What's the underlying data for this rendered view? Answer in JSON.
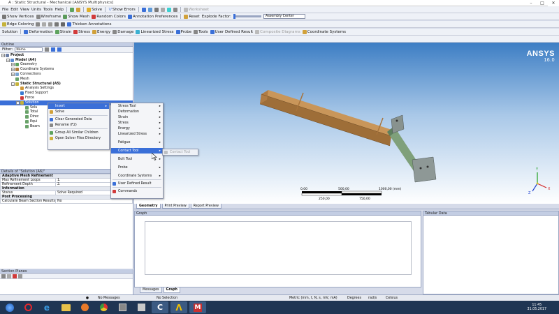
{
  "window": {
    "title": "A : Static Structural - Mechanical [ANSYS Multiphysics]",
    "buttons": [
      "–",
      "□",
      "✕"
    ]
  },
  "menubar": {
    "items": [
      "File",
      "Edit",
      "View",
      "Units",
      "Tools",
      "Help"
    ],
    "solve_label": "Solve",
    "show_errors_label": "Show Errors",
    "worksheet_label": "Worksheet"
  },
  "toolbar2": {
    "show_vertices": "Show Vertices",
    "wireframe": "Wireframe",
    "show_mesh": "Show Mesh",
    "random_colors": "Random Colors",
    "annotation_prefs": "Annotation Preferences",
    "reset": "Reset",
    "explode_label": "Explode Factor:",
    "assembly_center": "Assembly Center"
  },
  "toolbar3": {
    "edge_coloring": "Edge Coloring",
    "thicken_annotations": "Thicken Annotations"
  },
  "toolbar4": {
    "items": [
      "Solution",
      "Deformation",
      "Strain",
      "Stress",
      "Energy",
      "Damage",
      "Linearized Stress",
      "Probe",
      "Tools",
      "User Defined Result",
      "Coordinate Systems"
    ],
    "dimmed": "Composite Diagrams"
  },
  "outline": {
    "title": "Outline",
    "filter_label": "Filter:",
    "filter_value": "Name",
    "tree": [
      {
        "label": "Project",
        "indent": 0,
        "bold": true,
        "color": "#6b7ea6"
      },
      {
        "label": "Model (A4)",
        "indent": 1,
        "bold": true,
        "color": "#5b8bd1"
      },
      {
        "label": "Geometry",
        "indent": 2,
        "color": "#5ea35e"
      },
      {
        "label": "Coordinate Systems",
        "indent": 2,
        "color": "#b07a3a"
      },
      {
        "label": "Connections",
        "indent": 2,
        "color": "#7aa6d1"
      },
      {
        "label": "Mesh",
        "indent": 2,
        "color": "#6aa36a"
      },
      {
        "label": "Static Structural (A5)",
        "indent": 2,
        "bold": true,
        "color": "#c5b23a"
      },
      {
        "label": "Analysis Settings",
        "indent": 3,
        "color": "#d19a3a"
      },
      {
        "label": "Fixed Support",
        "indent": 3,
        "color": "#3a7ad1"
      },
      {
        "label": "Force",
        "indent": 3,
        "color": "#d13a3a"
      },
      {
        "label": "Solution",
        "indent": 3,
        "color": "#c5b23a",
        "selected": true
      },
      {
        "label": "Solu",
        "indent": 4,
        "color": "#6aa36a"
      },
      {
        "label": "Total",
        "indent": 4,
        "color": "#6aa36a"
      },
      {
        "label": "Direc",
        "indent": 4,
        "color": "#6aa36a"
      },
      {
        "label": "Equi",
        "indent": 4,
        "color": "#6aa36a"
      },
      {
        "label": "Beam",
        "indent": 4,
        "color": "#6aa36a"
      }
    ]
  },
  "details": {
    "title": "Details of \"Solution (A6)\"",
    "rows": [
      {
        "type": "group",
        "label": "Adaptive Mesh Refinement"
      },
      {
        "label": "Max Refinement Loops",
        "value": "1."
      },
      {
        "label": "Refinement Depth",
        "value": "2."
      },
      {
        "type": "group",
        "label": "Information"
      },
      {
        "label": "Status",
        "value": "Solve Required"
      },
      {
        "type": "group",
        "label": "Post Processing"
      },
      {
        "label": "Calculate Beam Section Results",
        "value": "No"
      }
    ]
  },
  "section_planes": {
    "title": "Section Planes"
  },
  "viewport": {
    "logo": "ANSYS",
    "version": "16.0",
    "scale_top": [
      "0,00",
      "500,00",
      "1000,00 (mm)"
    ],
    "scale_bottom": [
      "250,00",
      "750,00"
    ],
    "axes": [
      "Y",
      "X",
      "Z"
    ]
  },
  "context_menu": {
    "items": [
      {
        "label": "Insert",
        "highlight": true,
        "submenu": true
      },
      {
        "label": "Solve",
        "icon": "#d1a13a"
      },
      {
        "sep": true
      },
      {
        "label": "Clear Generated Data",
        "icon": "#3a6fd8"
      },
      {
        "label": "Rename (F2)",
        "icon": "#888"
      },
      {
        "sep": true
      },
      {
        "label": "Group All Similar Children",
        "icon": "#5ea35e"
      },
      {
        "label": "Open Solver Files Directory",
        "icon": "#d1b33a"
      }
    ]
  },
  "insert_submenu": {
    "items": [
      {
        "label": "Stress Tool",
        "submenu": true
      },
      {
        "label": "Deformation",
        "submenu": true
      },
      {
        "label": "Strain",
        "submenu": true
      },
      {
        "label": "Stress",
        "submenu": true
      },
      {
        "label": "Energy",
        "submenu": true
      },
      {
        "label": "Linearized Stress",
        "submenu": true
      },
      {
        "spacer": true
      },
      {
        "label": "Fatigue",
        "submenu": true
      },
      {
        "spacer": true
      },
      {
        "label": "Contact Tool",
        "submenu": true,
        "highlight": true
      },
      {
        "spacer": true
      },
      {
        "label": "Bolt Tool",
        "submenu": true
      },
      {
        "spacer": true
      },
      {
        "label": "Probe",
        "submenu": true
      },
      {
        "spacer": true
      },
      {
        "label": "Coordinate Systems",
        "submenu": true
      },
      {
        "sep": true
      },
      {
        "label": "User Defined Result",
        "icon": "#3a6fd8"
      },
      {
        "sep": true
      },
      {
        "label": "Commands",
        "icon": "#d13a3a"
      }
    ]
  },
  "contact_submenu": {
    "label": "Contact Tool"
  },
  "view_tabs": [
    "Geometry",
    "Print Preview",
    "Report Preview"
  ],
  "graph": {
    "title": "Graph"
  },
  "graph_tabs": [
    "Messages",
    "Graph"
  ],
  "tabular": {
    "title": "Tabular Data"
  },
  "statusbar": {
    "messages": "No Messages",
    "selection": "No Selection",
    "units": "Metric (mm, t, N, s, mV, mA)",
    "degrees": "Degrees",
    "rad": "rad/s",
    "temp": "Celsius"
  },
  "taskbar": {
    "time": "11:45",
    "date": "31.05.2017"
  },
  "colors": {
    "accent": "#3a6fd8",
    "beam": "#b8864b",
    "plate": "#5e7f5e"
  }
}
